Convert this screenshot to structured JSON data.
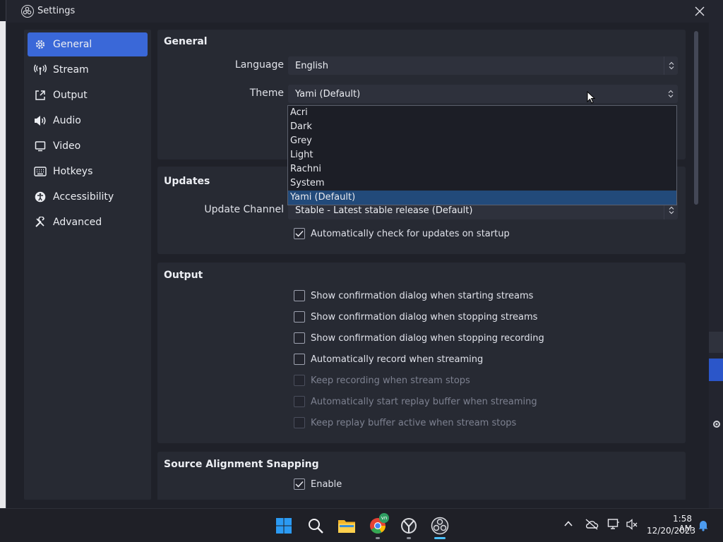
{
  "window": {
    "title": "Settings"
  },
  "sidebar": {
    "items": [
      {
        "label": "General",
        "icon": "gear-icon",
        "active": true
      },
      {
        "label": "Stream",
        "icon": "antenna-icon"
      },
      {
        "label": "Output",
        "icon": "output-icon"
      },
      {
        "label": "Audio",
        "icon": "speaker-icon"
      },
      {
        "label": "Video",
        "icon": "monitor-icon"
      },
      {
        "label": "Hotkeys",
        "icon": "keyboard-icon"
      },
      {
        "label": "Accessibility",
        "icon": "accessibility-icon"
      },
      {
        "label": "Advanced",
        "icon": "wrench-icon"
      }
    ]
  },
  "general": {
    "title": "General",
    "language_label": "Language",
    "language_value": "English",
    "theme_label": "Theme",
    "theme_value": "Yami (Default)"
  },
  "theme_dropdown": {
    "options": [
      "Acri",
      "Dark",
      "Grey",
      "Light",
      "Rachni",
      "System",
      "Yami (Default)"
    ],
    "selected": "Yami (Default)"
  },
  "updates": {
    "title": "Updates",
    "channel_label": "Update Channel",
    "channel_value": "Stable - Latest stable release (Default)",
    "auto_check_label": "Automatically check for updates on startup",
    "auto_check": true
  },
  "output": {
    "title": "Output",
    "options": [
      {
        "label": "Show confirmation dialog when starting streams",
        "checked": false,
        "enabled": true
      },
      {
        "label": "Show confirmation dialog when stopping streams",
        "checked": false,
        "enabled": true
      },
      {
        "label": "Show confirmation dialog when stopping recording",
        "checked": false,
        "enabled": true
      },
      {
        "label": "Automatically record when streaming",
        "checked": false,
        "enabled": true
      },
      {
        "label": "Keep recording when stream stops",
        "checked": false,
        "enabled": false
      },
      {
        "label": "Automatically start replay buffer when streaming",
        "checked": false,
        "enabled": false
      },
      {
        "label": "Keep replay buffer active when stream stops",
        "checked": false,
        "enabled": false
      }
    ]
  },
  "snapping": {
    "title": "Source Alignment Snapping",
    "enable_label": "Enable",
    "enabled": true
  },
  "taskbar": {
    "time": "1:58 AM",
    "date": "12/20/2023",
    "chrome_badge": "vn"
  },
  "colors": {
    "accent": "#3a68d8",
    "selected_option": "#224a7a",
    "window_bg": "#1f2129",
    "group_bg": "#272a33"
  }
}
